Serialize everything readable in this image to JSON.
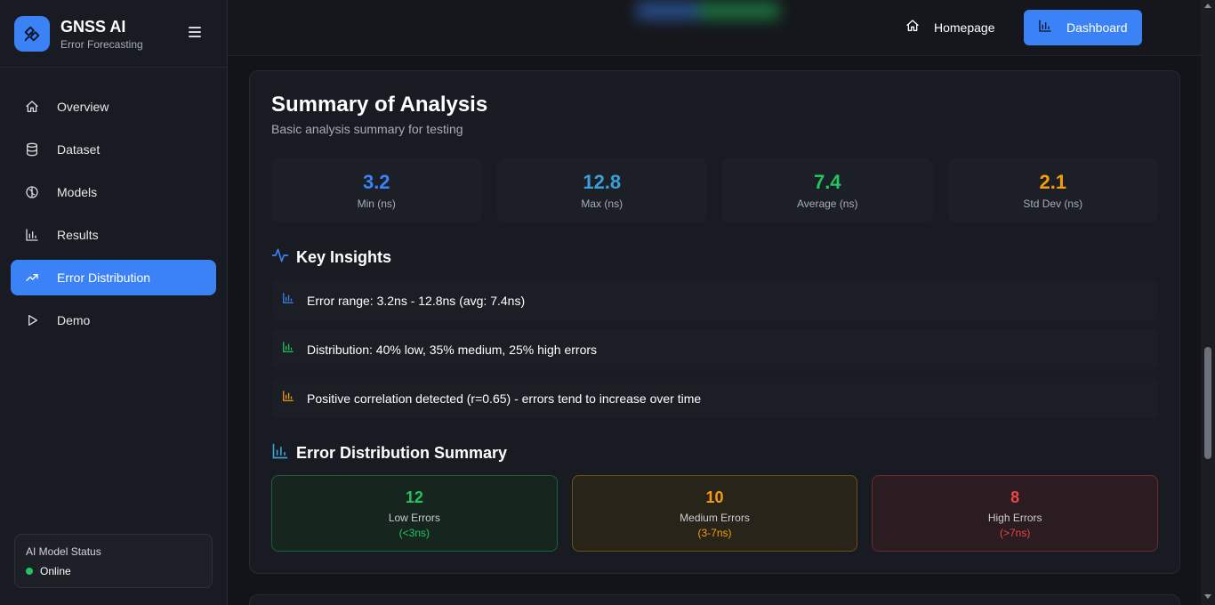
{
  "brand": {
    "title": "GNSS AI",
    "subtitle": "Error Forecasting",
    "icon": "satellite-icon"
  },
  "sidebar": {
    "items": [
      {
        "label": "Overview",
        "icon": "home-icon",
        "active": false
      },
      {
        "label": "Dataset",
        "icon": "database-icon",
        "active": false
      },
      {
        "label": "Models",
        "icon": "brain-icon",
        "active": false
      },
      {
        "label": "Results",
        "icon": "bar-chart-icon",
        "active": false
      },
      {
        "label": "Error Distribution",
        "icon": "trending-up-icon",
        "active": true
      },
      {
        "label": "Demo",
        "icon": "play-icon",
        "active": false
      }
    ],
    "status": {
      "title": "AI Model Status",
      "value": "Online",
      "color": "#22c55e"
    }
  },
  "header": {
    "home_label": "Homepage",
    "dashboard_label": "Dashboard"
  },
  "summary": {
    "title": "Summary of Analysis",
    "subtitle": "Basic analysis summary for testing",
    "stats": [
      {
        "value": "3.2",
        "label": "Min (ns)",
        "color": "#3b82f6"
      },
      {
        "value": "12.8",
        "label": "Max (ns)",
        "color": "#3aa0d8"
      },
      {
        "value": "7.4",
        "label": "Average (ns)",
        "color": "#22c55e"
      },
      {
        "value": "2.1",
        "label": "Std Dev (ns)",
        "color": "#f59e0b"
      }
    ]
  },
  "insights": {
    "title": "Key Insights",
    "items": [
      {
        "text": "Error range: 3.2ns - 12.8ns (avg: 7.4ns)",
        "color": "#3b82f6"
      },
      {
        "text": "Distribution: 40% low, 35% medium, 25% high errors",
        "color": "#22c55e"
      },
      {
        "text": "Positive correlation detected (r=0.65) - errors tend to increase over time",
        "color": "#f59e0b"
      }
    ]
  },
  "distribution": {
    "title": "Error Distribution Summary",
    "cards": [
      {
        "value": "12",
        "label": "Low Errors",
        "range": "(<3ns)",
        "color": "#22c55e"
      },
      {
        "value": "10",
        "label": "Medium Errors",
        "range": "(3-7ns)",
        "color": "#f59e0b"
      },
      {
        "value": "8",
        "label": "High Errors",
        "range": "(>7ns)",
        "color": "#ef4444"
      }
    ]
  },
  "colors": {
    "accent": "#3b82f6",
    "background": "#121419",
    "panel": "#181b21"
  }
}
